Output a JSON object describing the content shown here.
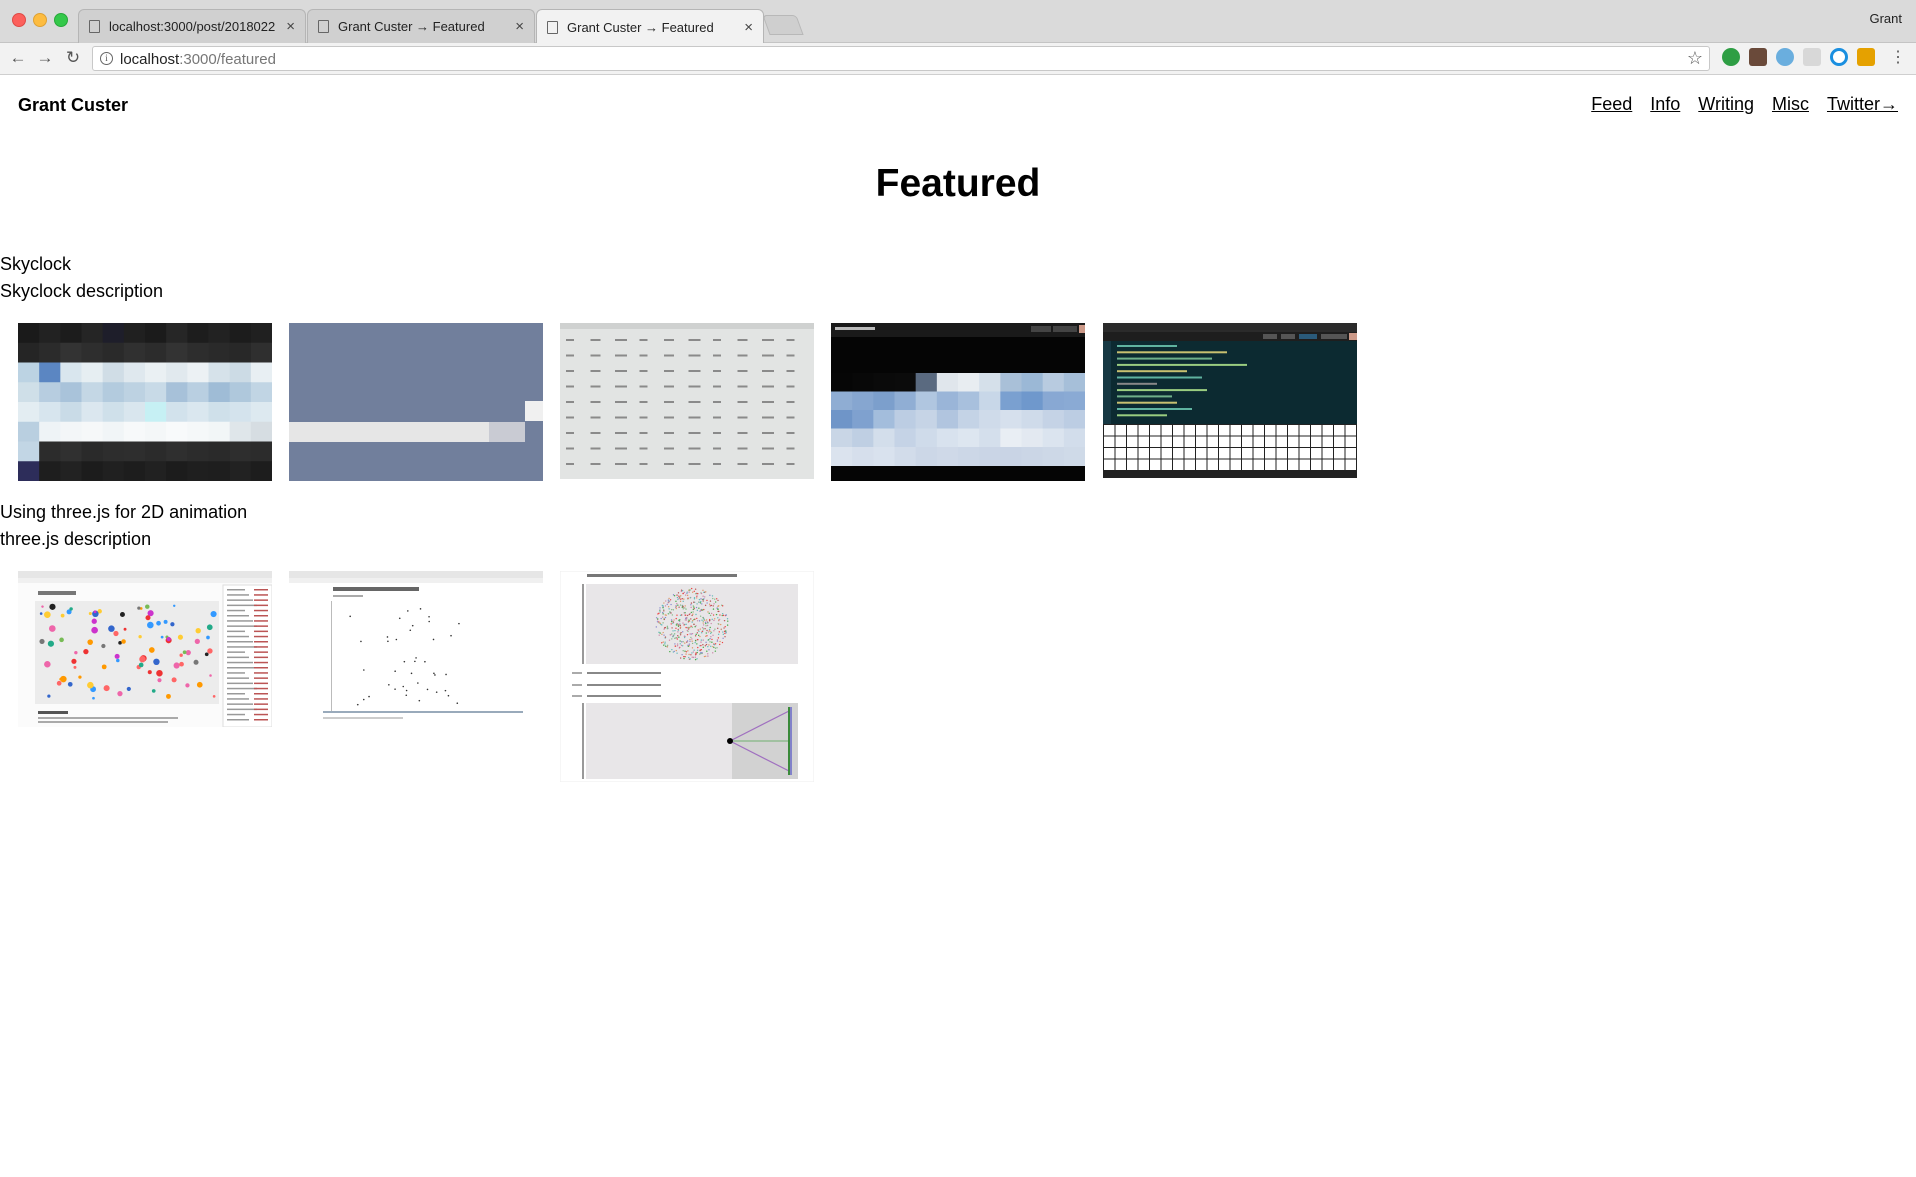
{
  "browser": {
    "tabs": [
      {
        "label": "localhost:3000/post/2018022",
        "close": "×"
      },
      {
        "label": "Grant Custer → Featured",
        "close": "×"
      },
      {
        "label": "Grant Custer → Featured",
        "close": "×"
      }
    ],
    "profile_name": "Grant",
    "url_host": "localhost",
    "url_path": ":3000/featured",
    "nav": {
      "back": "←",
      "forward": "→",
      "reload": "↻",
      "info": "i",
      "star": "☆"
    },
    "extension_colors": [
      "#2e9e44",
      "#6a4a3a",
      "#6aaede",
      "#d8d8d8",
      "#1a8fe0",
      "#e5a100"
    ]
  },
  "site": {
    "title": "Grant Custer",
    "nav": [
      "Feed",
      "Info",
      "Writing",
      "Misc",
      "Twitter→"
    ],
    "page_title": "Featured"
  },
  "projects": [
    {
      "title": "Skyclock",
      "description": "Skyclock description",
      "thumbnails": [
        {
          "icon": "pixel-sky-grid-thumbnail"
        },
        {
          "icon": "blue-band-thumbnail"
        },
        {
          "icon": "data-table-screenshot-thumbnail"
        },
        {
          "icon": "dark-app-pixel-thumbnail"
        },
        {
          "icon": "code-editor-grid-thumbnail"
        }
      ]
    },
    {
      "title": "Using three.js for 2D animation",
      "description": "three.js description",
      "thumbnails": [
        {
          "icon": "scatter-visualization-thumbnail"
        },
        {
          "icon": "threejs-points-thumbnail"
        },
        {
          "icon": "camera-fov-diagram-thumbnail"
        }
      ]
    }
  ],
  "colors": {
    "accent_blue": "#6f7f9f",
    "dark": "#1b1b1b",
    "editor": "#0d2b33"
  }
}
